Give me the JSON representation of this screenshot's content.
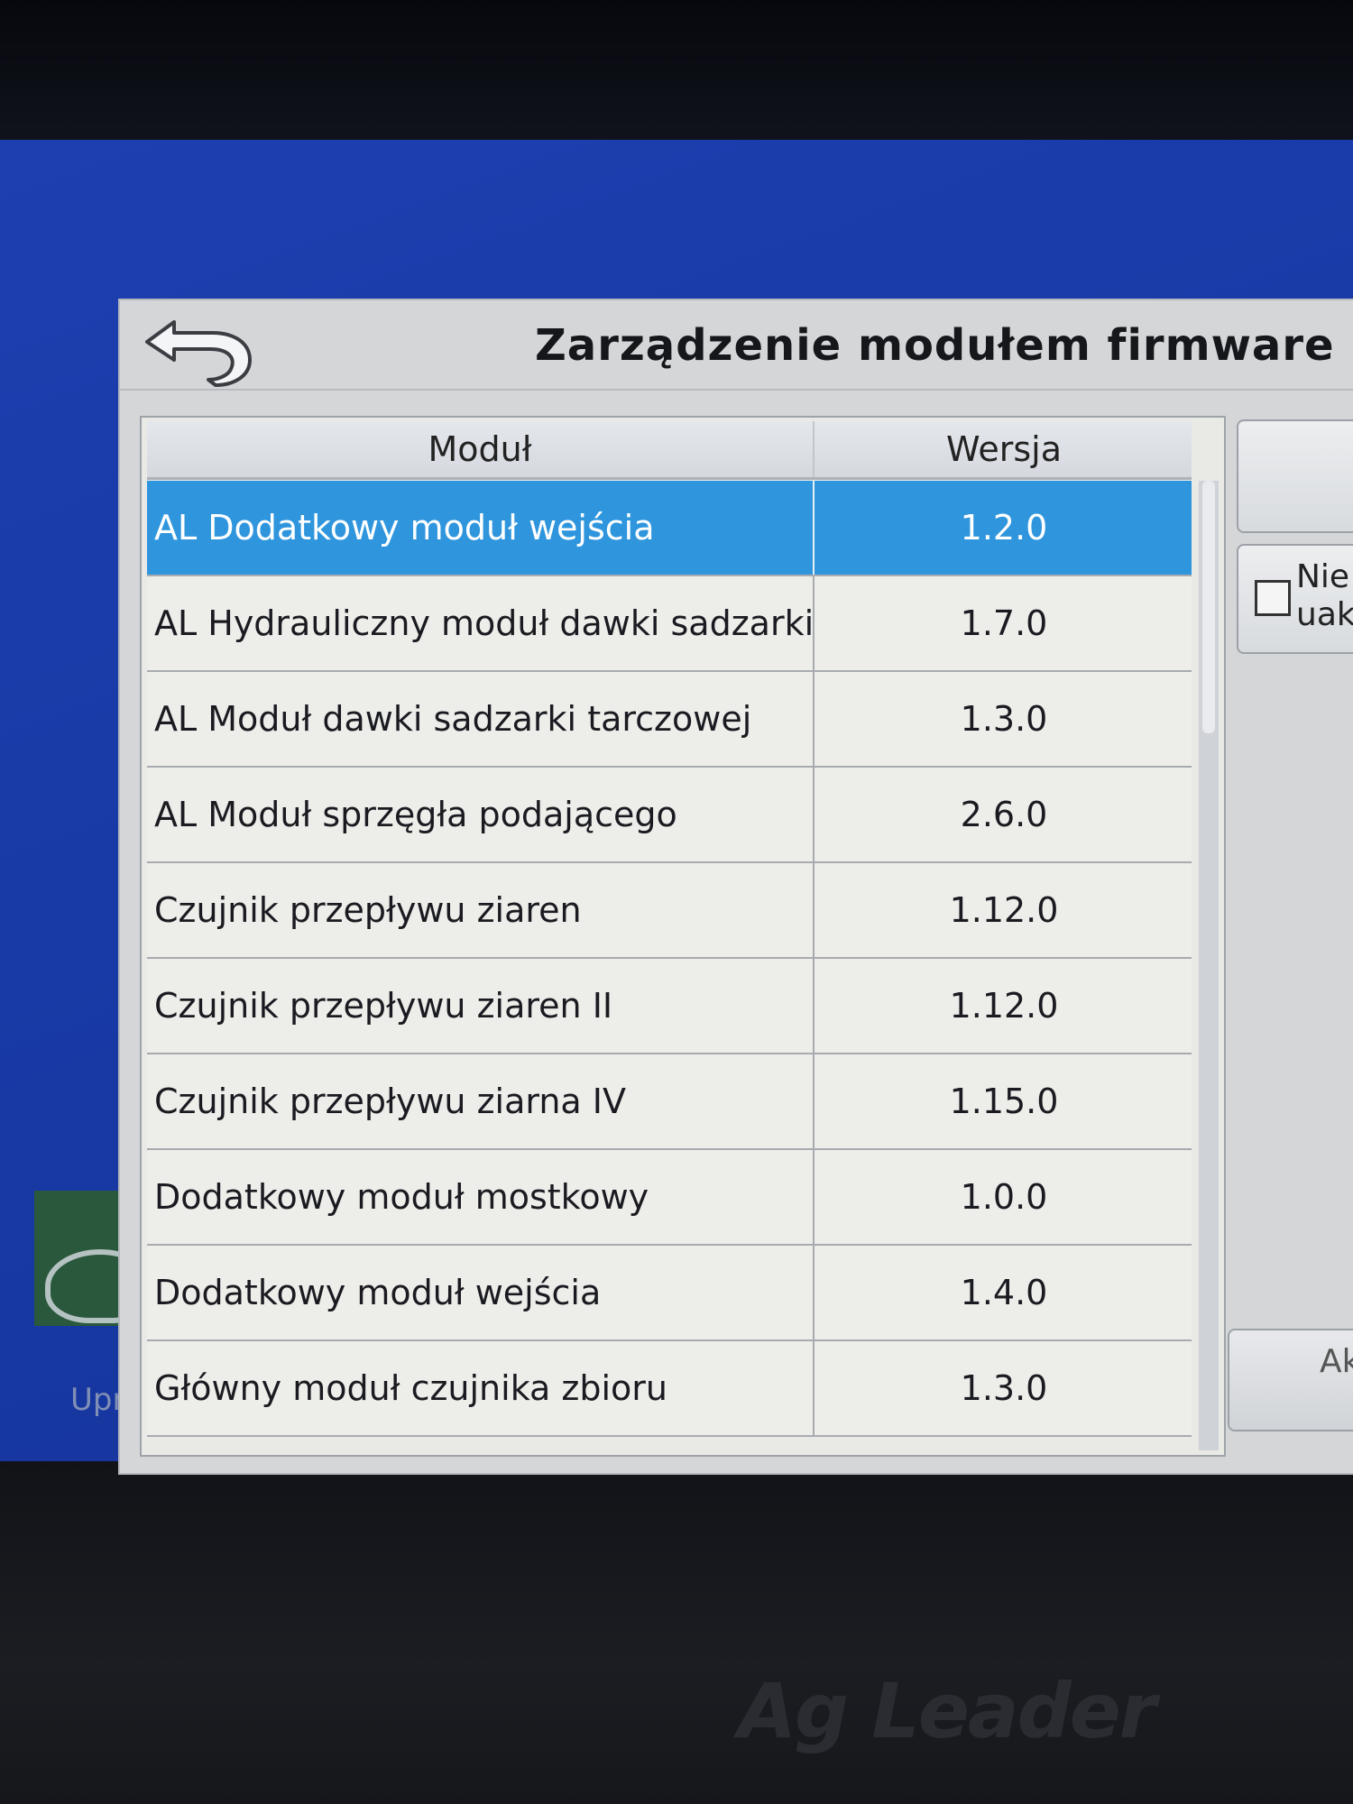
{
  "dialog": {
    "title": "Zarządzenie modułem firmware",
    "back_icon": "back-arrow-icon"
  },
  "table": {
    "columns": [
      "Moduł",
      "Wersja"
    ],
    "rows": [
      {
        "name": "AL Dodatkowy moduł wejścia",
        "version": "1.2.0",
        "selected": true
      },
      {
        "name": "AL Hydrauliczny moduł dawki sadzarki",
        "version": "1.7.0"
      },
      {
        "name": "AL Moduł dawki sadzarki tarczowej",
        "version": "1.3.0"
      },
      {
        "name": "AL Moduł sprzęgła podającego",
        "version": "2.6.0"
      },
      {
        "name": "Czujnik przepływu ziaren",
        "version": "1.12.0"
      },
      {
        "name": "Czujnik przepływu ziaren II",
        "version": "1.12.0"
      },
      {
        "name": "Czujnik przepływu ziarna IV",
        "version": "1.15.0"
      },
      {
        "name": "Dodatkowy moduł mostkowy",
        "version": "1.0.0"
      },
      {
        "name": "Dodatkowy moduł wejścia",
        "version": "1.4.0"
      },
      {
        "name": "Główny moduł czujnika zbioru",
        "version": "1.3.0"
      }
    ]
  },
  "side_panel": {
    "toggle_label_line1": "Nie",
    "toggle_label_line2": "uak",
    "bottom_button_label": "Ak"
  },
  "background": {
    "label": "Upra",
    "brand": "Ag Leader"
  },
  "colors": {
    "selected_row": "#2f96de",
    "screen_blue": "#1d3fb0"
  }
}
